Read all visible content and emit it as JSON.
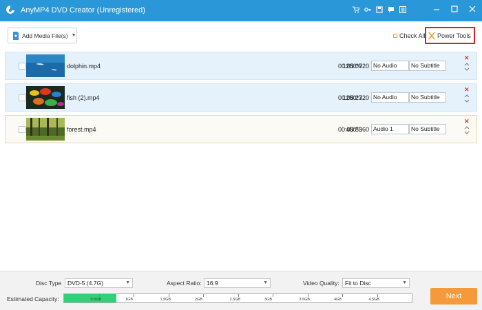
{
  "titlebar": {
    "title": "AnyMP4 DVD Creator (Unregistered)",
    "icons": [
      "cart-icon",
      "key-icon",
      "save-icon",
      "chat-icon",
      "menu-icon"
    ],
    "controls": [
      "minimize",
      "maximize",
      "close"
    ],
    "bg_color": "#2a97d8"
  },
  "toolbar": {
    "add_media_label": "Add Media File(s)",
    "check_all_label": "Check All",
    "power_tools_label": "Power Tools"
  },
  "files": [
    {
      "name": "dolphin.mp4",
      "resolution": "1280*720",
      "duration": "00:05:00",
      "audio": "No Audio",
      "subtitle": "No Subtitle",
      "thumb": "dolphin"
    },
    {
      "name": "fish (2).mp4",
      "resolution": "1280*720",
      "duration": "00:05:23",
      "audio": "No Audio",
      "subtitle": "No Subtitle",
      "thumb": "fish"
    },
    {
      "name": "forest.mp4",
      "resolution": "480*360",
      "duration": "00:05:55",
      "audio": "Audio 1",
      "subtitle": "No Subtitle",
      "thumb": "forest"
    }
  ],
  "bottom": {
    "disc_type_label": "Disc Type",
    "disc_type_value": "DVD-5 (4.7G)",
    "aspect_ratio_label": "Aspect Ratio:",
    "aspect_ratio_value": "16:9",
    "video_quality_label": "Video Quality:",
    "video_quality_value": "Fit to Disc",
    "capacity_label": "Estimated Capacity:",
    "capacity_ticks": [
      "0.5GB",
      "1GB",
      "1.5GB",
      "2GB",
      "2.5GB",
      "3GB",
      "3.5GB",
      "4GB",
      "4.5GB"
    ],
    "capacity_used_fraction": 0.15,
    "next_label": "Next",
    "accent_color": "#f59a3a"
  }
}
